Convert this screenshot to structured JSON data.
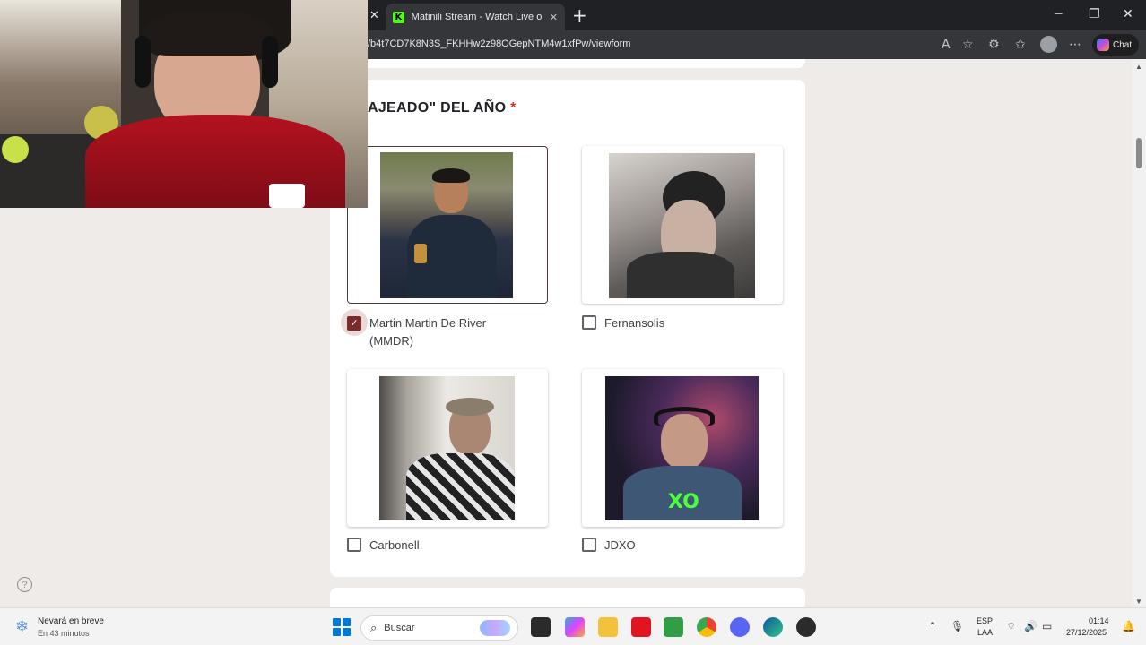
{
  "browser": {
    "tab_title": "Matinili Stream - Watch Live on Ki",
    "tab_favicon": "K",
    "url": "/b4t7CD7K8N3S_FKHHw2z98OGepNTM4w1xfPw/viewform",
    "chat_label": "Chat"
  },
  "form": {
    "question": "AJEADO\" DEL AÑO",
    "required_mark": "*",
    "options": [
      {
        "label": "Martin Martin De River (MMDR)",
        "checked": true
      },
      {
        "label": "Fernansolis",
        "checked": false
      },
      {
        "label": "Carbonell",
        "checked": false
      },
      {
        "label": "JDXO",
        "checked": false
      }
    ],
    "photo_overlay_text": "XO"
  },
  "taskbar": {
    "weather_title": "Nevará en breve",
    "weather_sub": "En 43 minutos",
    "search_placeholder": "Buscar",
    "lang_top": "ESP",
    "lang_bottom": "LAA",
    "time": "01:14",
    "date": "27/12/2025"
  },
  "colors": {
    "accent": "#7b2a2a",
    "kick_green": "#53fc18"
  }
}
